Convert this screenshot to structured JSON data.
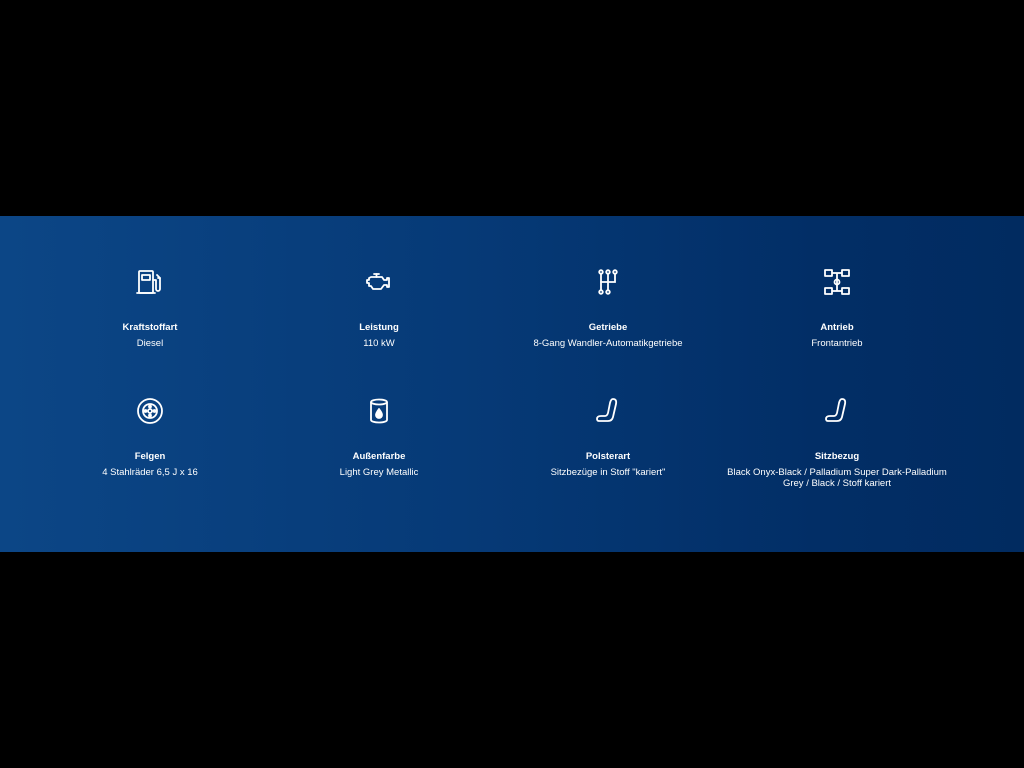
{
  "specs": [
    {
      "icon": "fuel-pump-icon",
      "label": "Kraftstoffart",
      "value": "Diesel"
    },
    {
      "icon": "engine-icon",
      "label": "Leistung",
      "value": "110 kW"
    },
    {
      "icon": "gear-shift-icon",
      "label": "Getriebe",
      "value": "8-Gang Wandler-Automatikgetriebe"
    },
    {
      "icon": "drivetrain-icon",
      "label": "Antrieb",
      "value": "Frontantrieb"
    },
    {
      "icon": "wheel-rim-icon",
      "label": "Felgen",
      "value": "4 Stahlräder 6,5 J x 16"
    },
    {
      "icon": "paint-can-icon",
      "label": "Außenfarbe",
      "value": "Light Grey Metallic"
    },
    {
      "icon": "seat-icon",
      "label": "Polsterart",
      "value": "Sitzbezüge in Stoff \"kariert\""
    },
    {
      "icon": "seat-icon",
      "label": "Sitzbezug",
      "value": "Black Onyx-Black / Palladium Super Dark-Palladium\nGrey / Black / Stoff kariert"
    }
  ],
  "colors": {
    "band_start": "#0c4686",
    "band_end": "#012b60",
    "text": "#ffffff"
  }
}
